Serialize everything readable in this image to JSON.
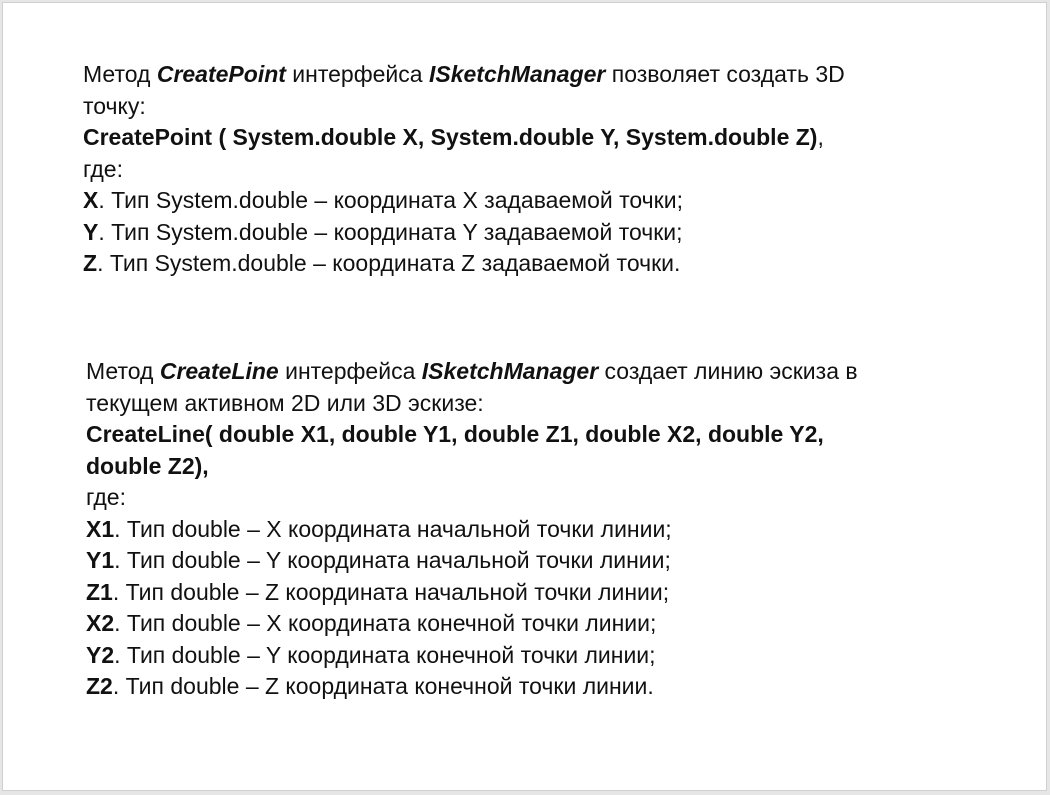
{
  "slide": {
    "section1": {
      "intro": {
        "p1": "Метод ",
        "method": "CreatePoint",
        "p2": " интерфейса ",
        "iface": "ISketchManager",
        "p3": " позволяет создать 3D",
        "p4": "точку:"
      },
      "signature": {
        "code": "CreatePoint ( System.double X, System.double Y, System.double Z)",
        "tail": ","
      },
      "where": "где:",
      "params": [
        {
          "name": "X",
          "desc": ". Тип System.double – координата X задаваемой точки;"
        },
        {
          "name": "Y",
          "desc": ". Тип System.double – координата Y задаваемой точки;"
        },
        {
          "name": "Z",
          "desc": ". Тип System.double – координата Z задаваемой точки."
        }
      ]
    },
    "section2": {
      "intro": {
        "p1": "Метод ",
        "method": "CreateLine",
        "p2": " интерфейса ",
        "iface": "ISketchManager",
        "p3": " создает линию эскиза в",
        "p4": "текущем активном 2D или 3D эскизе:"
      },
      "signature": {
        "line1": "CreateLine( double X1,  double Y1,  double Z1,  double X2,  double Y2,",
        "line2": "double Z2),"
      },
      "where": "где:",
      "params": [
        {
          "name": "X1",
          "desc": ". Тип  double – X координата начальной точки линии;"
        },
        {
          "name": "Y1",
          "desc": ". Тип  double – Y координата начальной точки линии;"
        },
        {
          "name": "Z1",
          "desc": ". Тип  double – Z координата начальной точки линии;"
        },
        {
          "name": "X2",
          "desc": ". Тип  double – X координата конечной точки линии;"
        },
        {
          "name": "Y2",
          "desc": ". Тип  double – Y координата конечной точки линии;"
        },
        {
          "name": "Z2",
          "desc": ". Тип  double – Z координата конечной точки линии."
        }
      ]
    }
  }
}
